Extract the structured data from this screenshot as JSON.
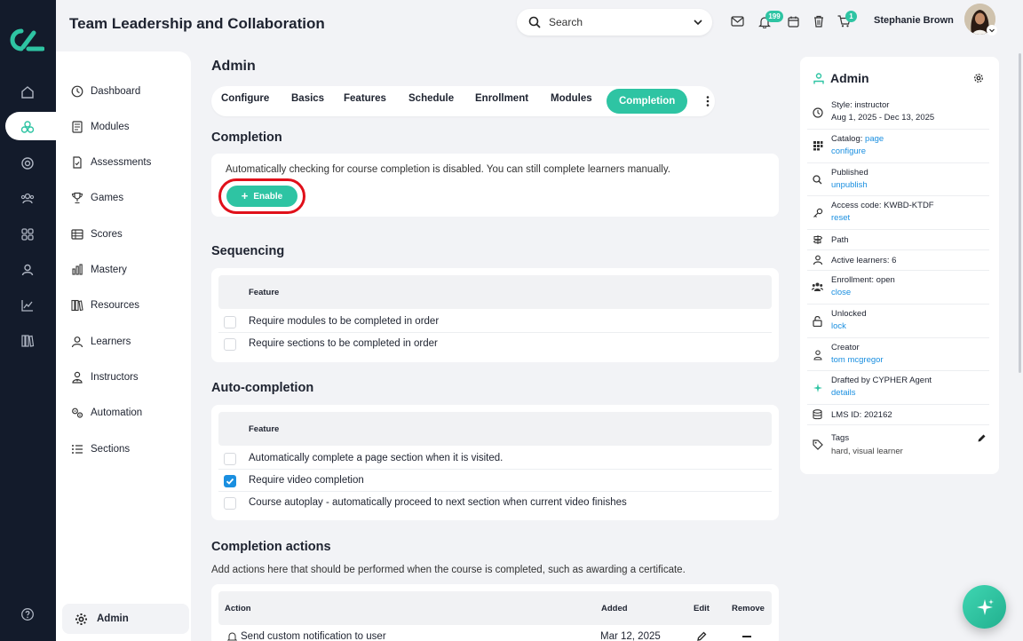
{
  "app": {
    "title": "Team Leadership and Collaboration"
  },
  "header": {
    "search_placeholder": "Search",
    "notification_count": "199",
    "cart_count": "1",
    "user_name": "Stephanie Brown",
    "icons": [
      "mail-icon",
      "bell-icon",
      "calendar-icon",
      "trash-icon",
      "cart-icon"
    ]
  },
  "sidebar": {
    "items": [
      {
        "label": "Dashboard",
        "icon": "dashboard-icon"
      },
      {
        "label": "Modules",
        "icon": "modules-icon"
      },
      {
        "label": "Assessments",
        "icon": "assessments-icon"
      },
      {
        "label": "Games",
        "icon": "trophy-icon"
      },
      {
        "label": "Scores",
        "icon": "scores-icon"
      },
      {
        "label": "Mastery",
        "icon": "mastery-icon"
      },
      {
        "label": "Resources",
        "icon": "resources-icon"
      },
      {
        "label": "Learners",
        "icon": "learners-icon"
      },
      {
        "label": "Instructors",
        "icon": "instructors-icon"
      },
      {
        "label": "Automation",
        "icon": "automation-icon"
      },
      {
        "label": "Sections",
        "icon": "sections-icon"
      }
    ],
    "admin_label": "Admin"
  },
  "main": {
    "heading": "Admin",
    "tabs": [
      "Configure",
      "Basics",
      "Features",
      "Schedule",
      "Enrollment",
      "Modules",
      "Completion"
    ],
    "active_tab": "Completion",
    "completion": {
      "title": "Completion",
      "message": "Automatically checking for course completion is disabled. You can still complete learners manually.",
      "enable_label": "Enable"
    },
    "sequencing": {
      "title": "Sequencing",
      "header": "Feature",
      "rows": [
        {
          "label": "Require modules to be completed in order",
          "checked": false
        },
        {
          "label": "Require sections to be completed in order",
          "checked": false
        }
      ]
    },
    "autocompletion": {
      "title": "Auto-completion",
      "header": "Feature",
      "rows": [
        {
          "label": "Automatically complete a page section when it is visited.",
          "checked": false
        },
        {
          "label": "Require video completion",
          "checked": true
        },
        {
          "label": "Course autoplay - automatically proceed to next section when current video finishes",
          "checked": false
        }
      ]
    },
    "actions": {
      "title": "Completion actions",
      "subtitle": "Add actions here that should be performed when the course is completed, such as awarding a certificate.",
      "columns": [
        "Action",
        "Added",
        "Edit",
        "Remove"
      ],
      "rows": [
        {
          "action": "Send custom notification to user",
          "added": "Mar 12, 2025"
        }
      ]
    }
  },
  "right_panel": {
    "title": "Admin",
    "rows": [
      {
        "label": "Style: instructor",
        "value": "Aug 1, 2025 - Dec 13, 2025",
        "link": false,
        "icon": "clock-icon"
      },
      {
        "label": "Catalog: ",
        "inline_link": "page",
        "value": "configure",
        "link": true,
        "icon": "catalog-icon"
      },
      {
        "label": "Published",
        "value": "unpublish",
        "link": true,
        "icon": "search-icon"
      },
      {
        "label": "Access code: KWBD-KTDF",
        "value": "reset",
        "link": true,
        "icon": "key-icon"
      },
      {
        "label": "Path",
        "value": "",
        "link": false,
        "icon": "path-icon"
      },
      {
        "label": "Active learners: 6",
        "value": "",
        "link": false,
        "icon": "person-icon"
      },
      {
        "label": "Enrollment: open",
        "value": "close",
        "link": true,
        "icon": "group-icon"
      },
      {
        "label": "Unlocked",
        "value": "lock",
        "link": true,
        "icon": "unlock-icon"
      },
      {
        "label": "Creator",
        "value": "tom mcgregor",
        "link": true,
        "icon": "creator-icon"
      },
      {
        "label": "Drafted by CYPHER Agent",
        "value": "details",
        "link": true,
        "icon": "sparkle-icon"
      },
      {
        "label": "LMS ID: 202162",
        "value": "",
        "link": false,
        "icon": "database-icon"
      },
      {
        "label": "Tags",
        "value": "hard, visual learner",
        "link": false,
        "icon": "tag-icon"
      }
    ]
  },
  "colors": {
    "accent": "#2ec4a3",
    "rail": "#131b2b",
    "link": "#1a8fe0",
    "highlight": "#e0101a"
  }
}
